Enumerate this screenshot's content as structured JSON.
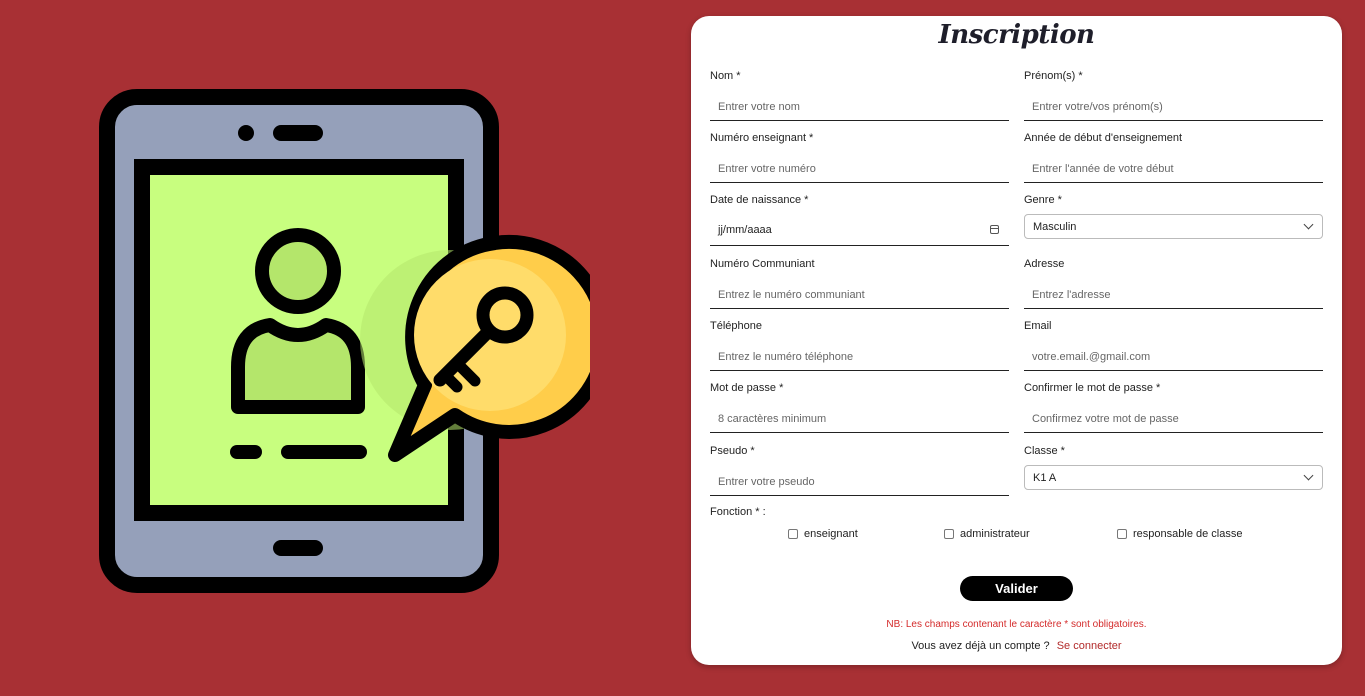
{
  "form": {
    "title": "Inscription",
    "fields": [
      {
        "label": "Nom *",
        "placeholder": "Entrer votre nom"
      },
      {
        "label": "Prénom(s) *",
        "placeholder": "Entrer votre/vos prénom(s)"
      },
      {
        "label": "Numéro enseignant *",
        "placeholder": "Entrer votre numéro"
      },
      {
        "label": "Année de début d'enseignement",
        "placeholder": "Entrer l'année de votre début"
      },
      {
        "label": "Date de naissance *",
        "value": "jj/mm/aaaa"
      },
      {
        "label": "Genre *",
        "value": "Masculin"
      },
      {
        "label": "Numéro Communiant",
        "placeholder": "Entrez le numéro communiant"
      },
      {
        "label": "Adresse",
        "placeholder": "Entrez l'adresse"
      },
      {
        "label": "Téléphone",
        "placeholder": "Entrez le numéro téléphone"
      },
      {
        "label": "Email",
        "placeholder": "votre.email.@gmail.com"
      },
      {
        "label": "Mot de passe *",
        "placeholder": "8 caractères minimum"
      },
      {
        "label": "Confirmer le mot de passe *",
        "placeholder": "Confirmez votre mot de passe"
      },
      {
        "label": "Pseudo *",
        "placeholder": "Entrer votre pseudo"
      },
      {
        "label": "Classe *",
        "value": "K1 A"
      }
    ],
    "fonction": {
      "label": "Fonction * :",
      "options": [
        "enseignant",
        "administrateur",
        "responsable de classe"
      ]
    },
    "submit_label": "Valider",
    "note": "NB: Les champs contenant le caractère * sont obligatoires.",
    "login_prompt": "Vous avez déjà un compte ?",
    "login_link": "Se connecter"
  },
  "illustration": {
    "icon": "tablet-user-key-icon"
  },
  "colors": {
    "background": "#a83034",
    "accent": "#000000",
    "note": "#d42b2b"
  }
}
